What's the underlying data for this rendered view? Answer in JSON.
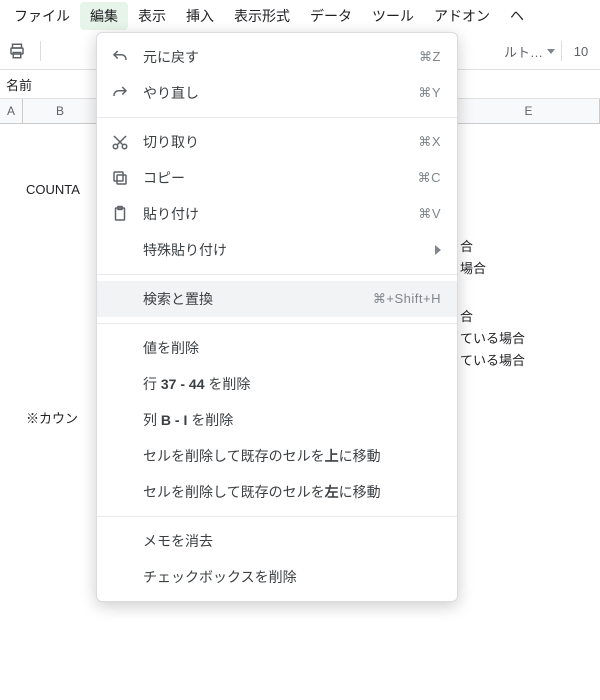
{
  "menubar": {
    "items": [
      "ファイル",
      "編集",
      "表示",
      "挿入",
      "表示形式",
      "データ",
      "ツール",
      "アドオン",
      "ヘ"
    ],
    "active_index": 1
  },
  "toolbar": {
    "font_dropdown_label": "ルト…",
    "font_size": "10"
  },
  "namebox": {
    "label": "名前"
  },
  "columns": {
    "A": "A",
    "B": "B",
    "E": "E"
  },
  "sheet": {
    "cell_b3": "COUNTA",
    "cell_e6": "合",
    "cell_e7": "場合",
    "cell_e9": "合",
    "cell_e10": "ている場合",
    "cell_e11": "ている場合",
    "cell_b14": "※カウン"
  },
  "menu": {
    "undo": {
      "label": "元に戻す",
      "shortcut": "⌘Z"
    },
    "redo": {
      "label": "やり直し",
      "shortcut": "⌘Y"
    },
    "cut": {
      "label": "切り取り",
      "shortcut": "⌘X"
    },
    "copy": {
      "label": "コピー",
      "shortcut": "⌘C"
    },
    "paste": {
      "label": "貼り付け",
      "shortcut": "⌘V"
    },
    "paste_special": {
      "label": "特殊貼り付け"
    },
    "find_replace": {
      "label": "検索と置換",
      "shortcut": "⌘+Shift+H"
    },
    "delete_values": {
      "label": "値を削除"
    },
    "delete_rows_pre": "行 ",
    "delete_rows_range": "37 - 44",
    "delete_rows_post": " を削除",
    "delete_cols_pre": "列 ",
    "delete_cols_range": "B - I",
    "delete_cols_post": " を削除",
    "delete_shift_up_pre": "セルを削除して既存のセルを",
    "delete_shift_up_bold": "上",
    "delete_shift_up_post": "に移動",
    "delete_shift_left_pre": "セルを削除して既存のセルを",
    "delete_shift_left_bold": "左",
    "delete_shift_left_post": "に移動",
    "clear_notes": {
      "label": "メモを消去"
    },
    "remove_checkboxes": {
      "label": "チェックボックスを削除"
    }
  }
}
